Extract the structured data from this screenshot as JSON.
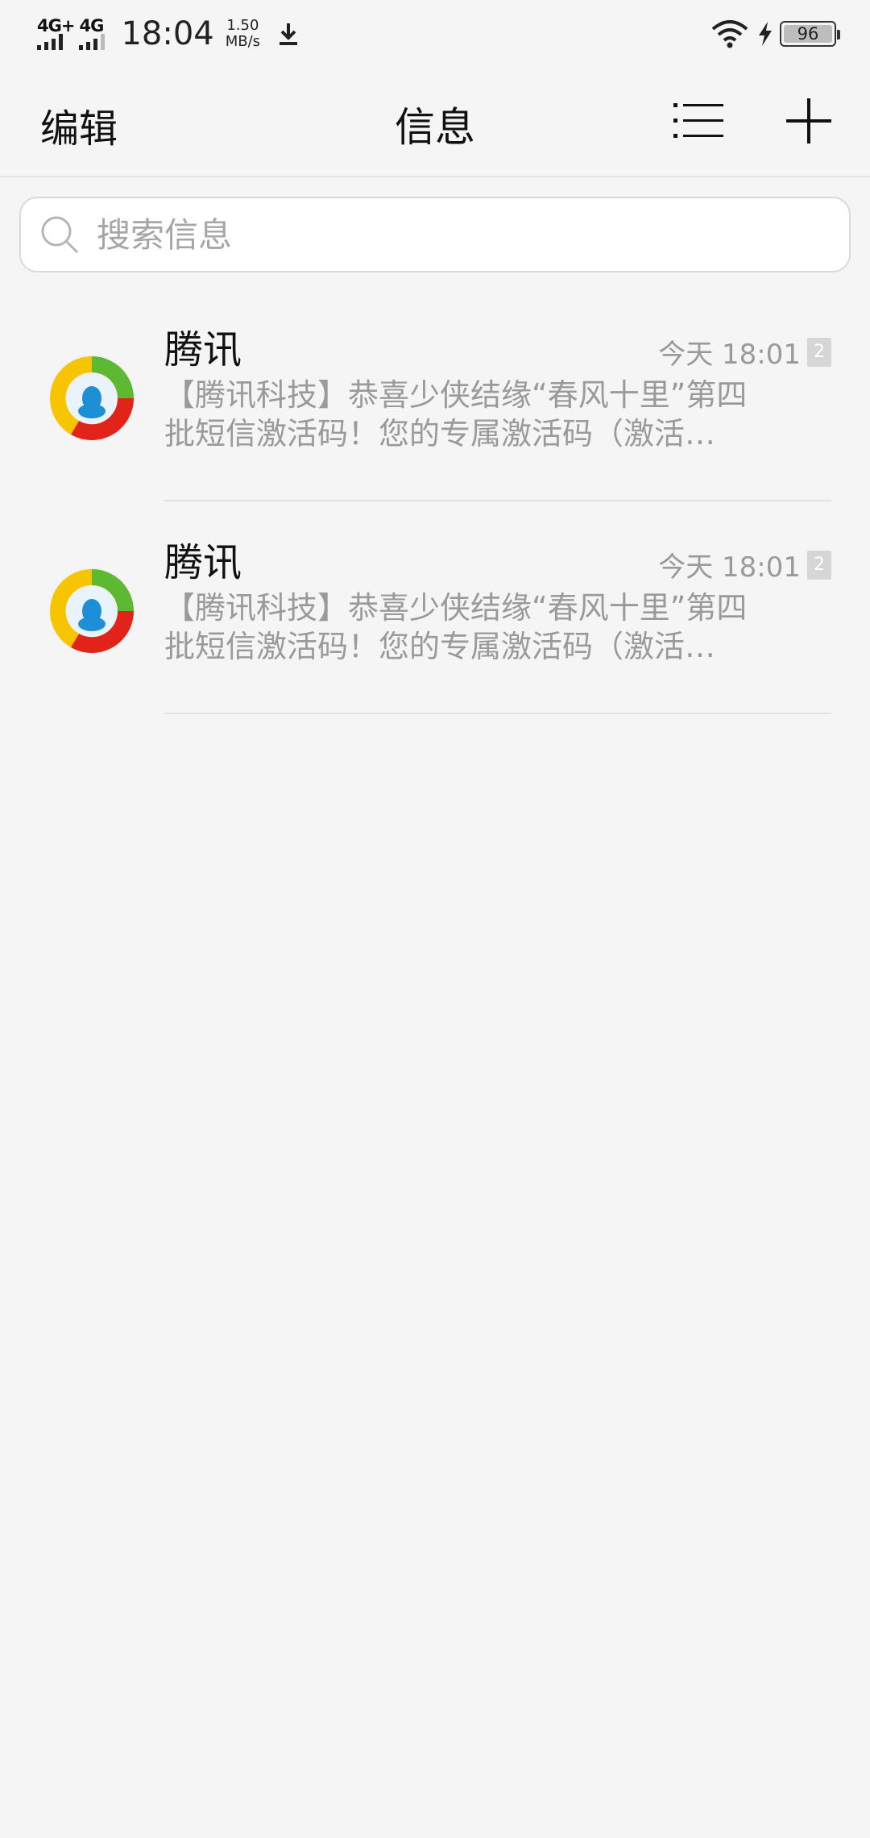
{
  "status_bar": {
    "network_1": "4G+",
    "network_2": "4G",
    "time": "18:04",
    "speed_value": "1.50",
    "speed_unit": "MB/s",
    "battery": "96",
    "battery_level_percent": 96
  },
  "header": {
    "edit_label": "编辑",
    "title": "信息",
    "list_icon": "list-icon",
    "add_icon": "plus-icon"
  },
  "search": {
    "placeholder": "搜索信息",
    "value": ""
  },
  "conversations": [
    {
      "sender": "腾讯",
      "time": "今天 18:01",
      "unread_count": "2",
      "preview": "【腾讯科技】恭喜少侠结缘“春风十里”第四批短信激活码！您的专属激活码（激活…",
      "avatar_icon": "tencent-logo"
    },
    {
      "sender": "腾讯",
      "time": "今天 18:01",
      "unread_count": "2",
      "preview": "【腾讯科技】恭喜少侠结缘“春风十里”第四批短信激活码！您的专属激活码（激活…",
      "avatar_icon": "tencent-logo"
    }
  ],
  "colors": {
    "background": "#f5f5f5",
    "secondary_text": "#9a9a9a",
    "divider": "#e2e2e2"
  }
}
